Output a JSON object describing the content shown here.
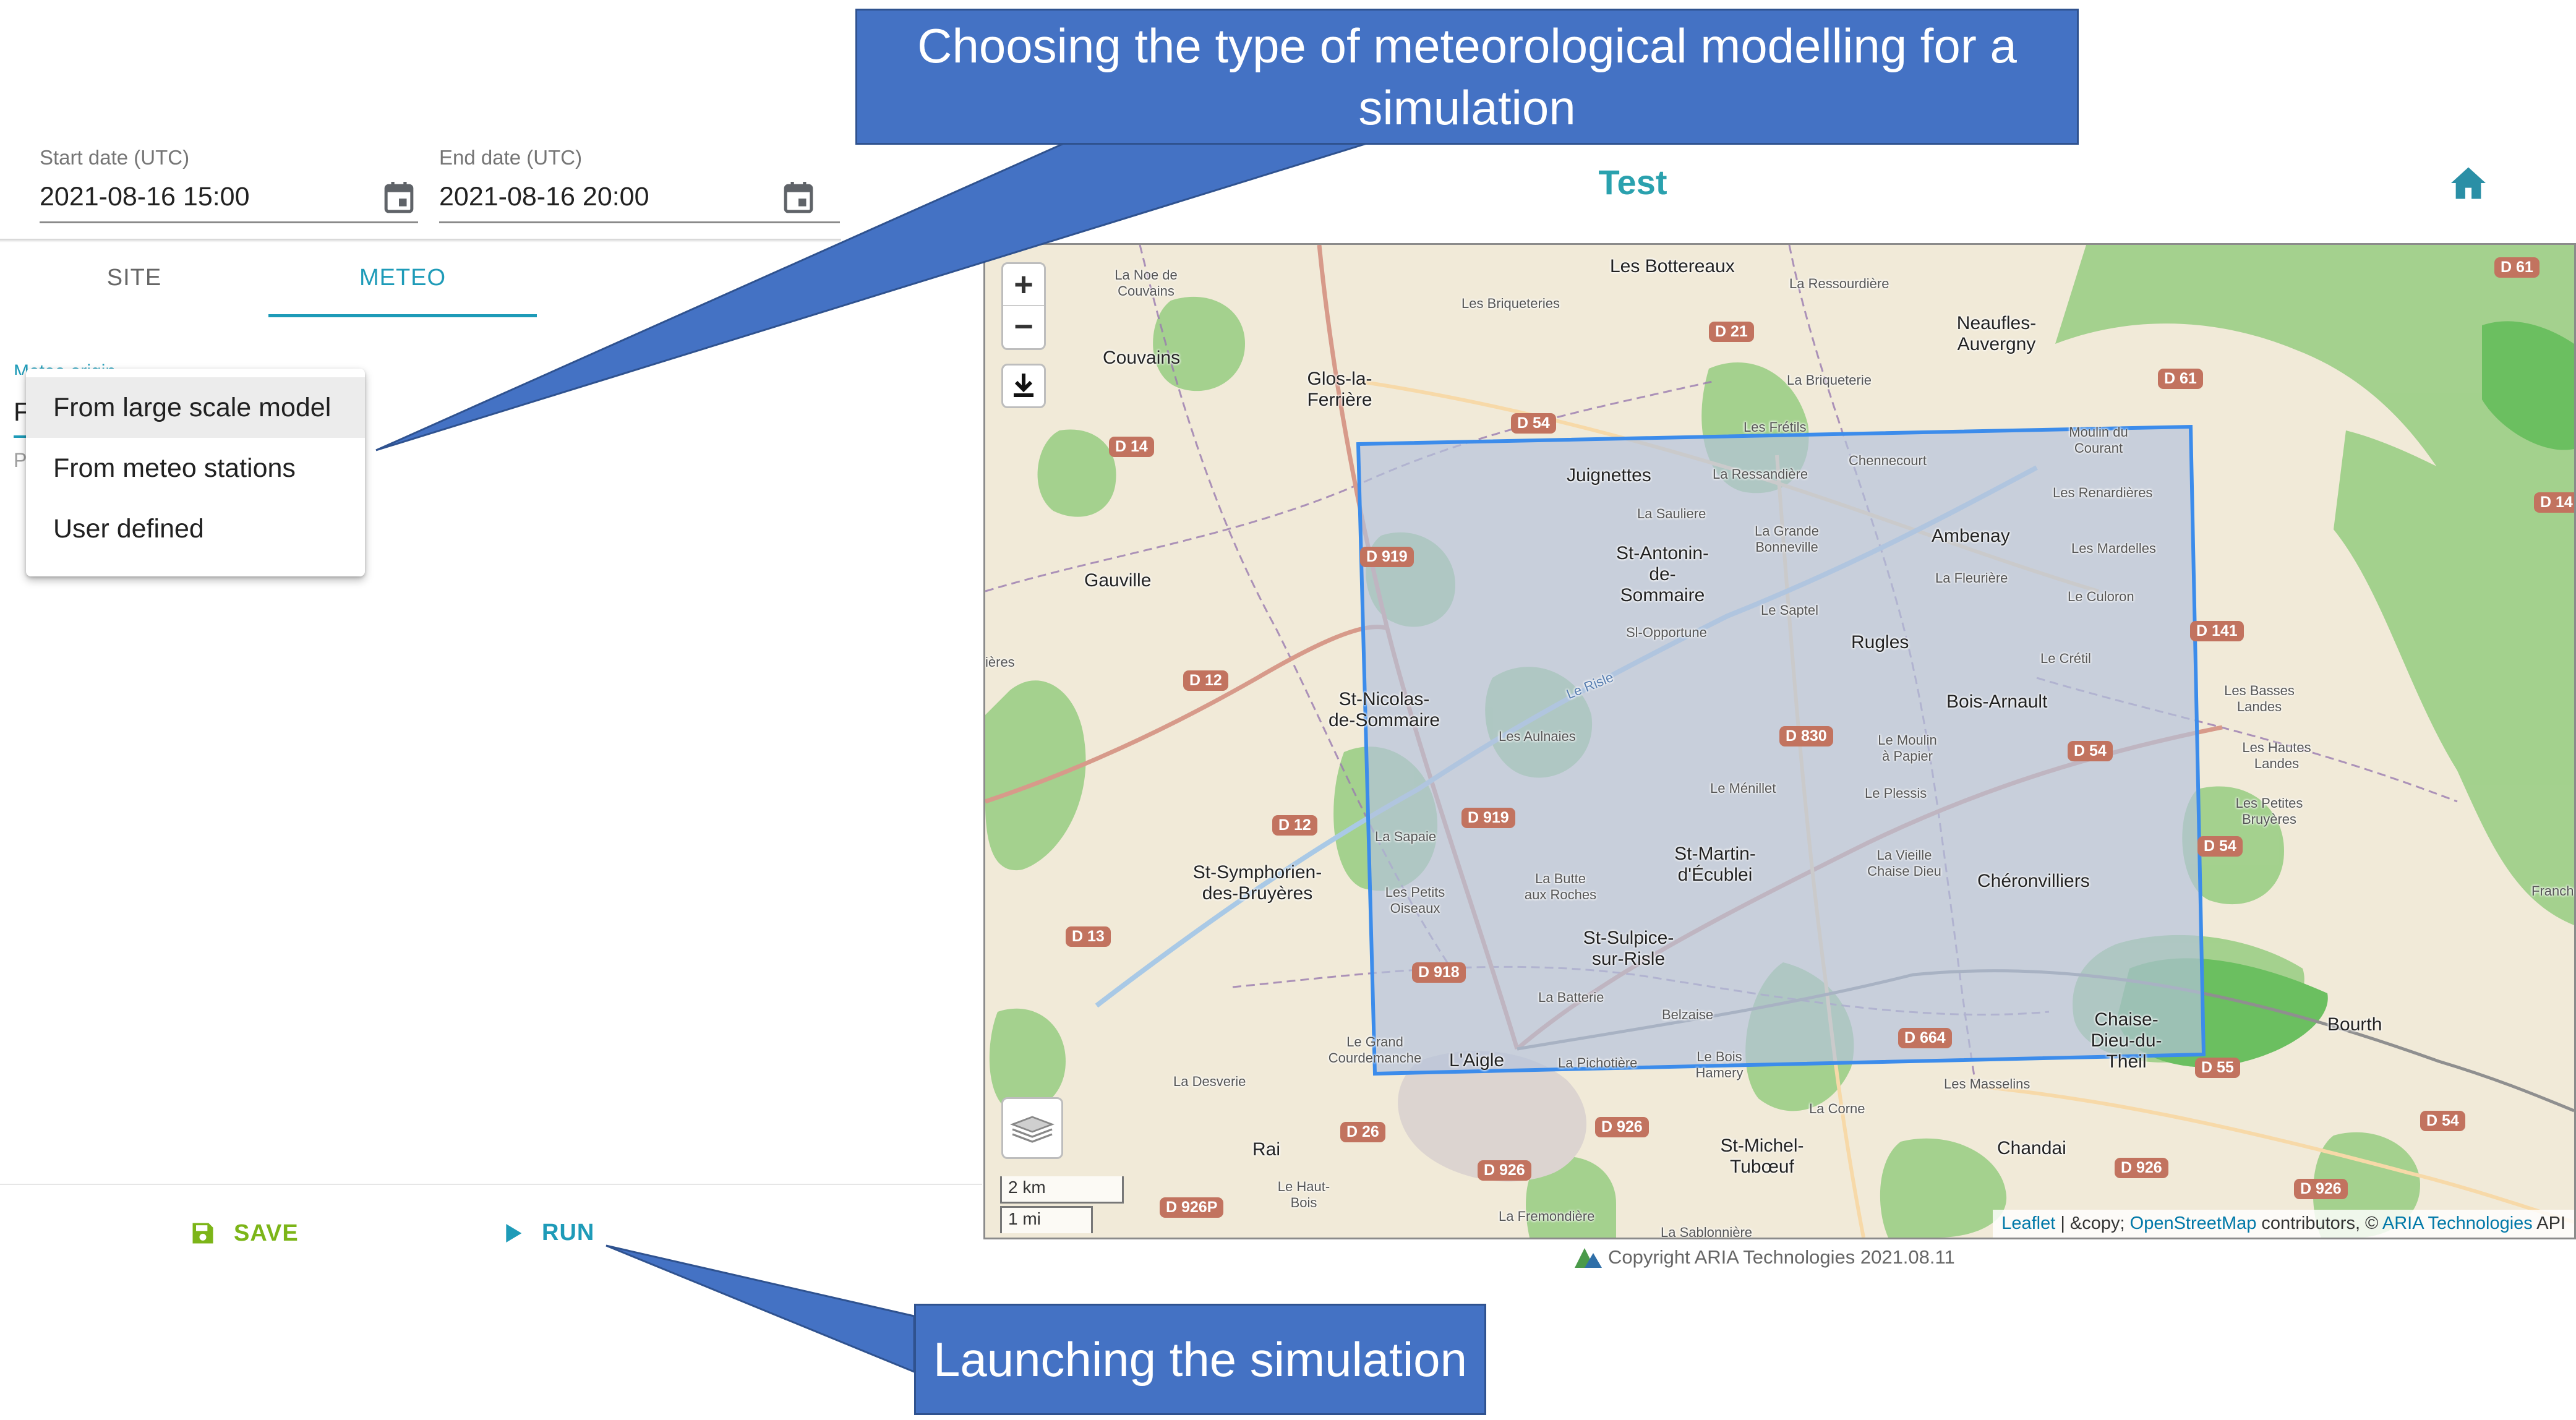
{
  "dates": {
    "start_label": "Start date (UTC)",
    "start_value": "2021-08-16 15:00",
    "end_label": "End date (UTC)",
    "end_value": "2021-08-16 20:00",
    "icon": "calendar-icon"
  },
  "tabs": [
    {
      "label": "SITE",
      "active": false
    },
    {
      "label": "METEO",
      "active": true
    }
  ],
  "meteo": {
    "origin_label_partial": "Meteo origin",
    "field_fragment": "F",
    "second_fragment": "P"
  },
  "dropdown": {
    "options": [
      "From large scale model",
      "From meteo stations",
      "User defined"
    ],
    "highlighted_index": 0
  },
  "actions": {
    "save_label": "SAVE",
    "run_label": "RUN",
    "save_icon": "floppy-disk-icon",
    "run_icon": "play-icon"
  },
  "header": {
    "title": "Test",
    "home_icon": "home-icon"
  },
  "map": {
    "zoom_in": "+",
    "zoom_out": "−",
    "download_icon": "download-icon",
    "layers_icon": "layers-icon",
    "scale_km": "2 km",
    "scale_mi": "1 mi",
    "attribution": {
      "leaflet": "Leaflet",
      "sep": " | &copy; ",
      "osm": "OpenStreetMap",
      "contrib": " contributors, © ",
      "aria": "ARIA Technologies",
      "api": " API"
    },
    "places": [
      "La Noe de Couvains",
      "Les Bottereaux",
      "Les Briqueteries",
      "La Ressourdière",
      "Neaufles-Auvergny",
      "Couvains",
      "Glos-la-Ferrière",
      "La Briqueterie",
      "Les Frétils",
      "Juignettes",
      "La Ressandière",
      "Chennecourt",
      "Les Renardières",
      "St-Antonin-de-Sommaire",
      "Ambenay",
      "Les Mardelles",
      "Gauville",
      "La Fleurière",
      "Le Culoron",
      "Rugles",
      "St-Nicolas-de-Sommaire",
      "Bois-Arnault",
      "Le Moulin à Papier",
      "St-Symphorien-des-Bruyères",
      "St-Martin-d'Écublei",
      "Chéronvilliers",
      "St-Sulpice-sur-Risle",
      "Les Petites Bruyères",
      "Les Hautes Landes",
      "L'Aigle",
      "Chaise-Dieu-du-Theil",
      "Bourth",
      "Rai",
      "St-Michel-Tubœuf",
      "Chandai",
      "La Fremondière",
      "La Sablonnière",
      "Le Grand Courdemanche",
      "La Desverie",
      "Le Haut-Bois",
      "Les Masselins",
      "La Corne",
      "Belzaise",
      "Le Bois Hamery",
      "La Pichotière",
      "La Batterie",
      "La Butte aux Roches",
      "Les Petits Oiseaux",
      "La Sapaie",
      "Les Aulnaies",
      "La Vieille Chaise Dieu",
      "Le Plessis",
      "Le Ménillet",
      "Le Crétil",
      "Les Basses Landes",
      "Sl-Opportune",
      "Le Saptel",
      "La Sauliere",
      "La Grande Bonneville",
      "Moulin du Courant",
      "Franche",
      "ières"
    ],
    "roads": [
      "D 61",
      "D 21",
      "D 14",
      "D 54",
      "D 61",
      "D 919",
      "D 141",
      "D 12",
      "D 830",
      "D 54",
      "D 919",
      "D 12",
      "D 54",
      "D 13",
      "D 918",
      "D 664",
      "D 55",
      "D 26",
      "D 926",
      "D 926",
      "D 54",
      "D 926",
      "D 926",
      "D 926P",
      "D 14"
    ],
    "river": "Le Risle"
  },
  "footer": {
    "copyright": "Copyright ARIA Technologies 2021.08.11"
  },
  "callouts": {
    "top": "Choosing the type of meteorological modelling for a simulation",
    "bottom": "Launching the simulation"
  },
  "colors": {
    "accent": "#1e9bb8",
    "save": "#7cb518",
    "callout": "#4472c4",
    "domain_box": "#3c8ceb"
  }
}
